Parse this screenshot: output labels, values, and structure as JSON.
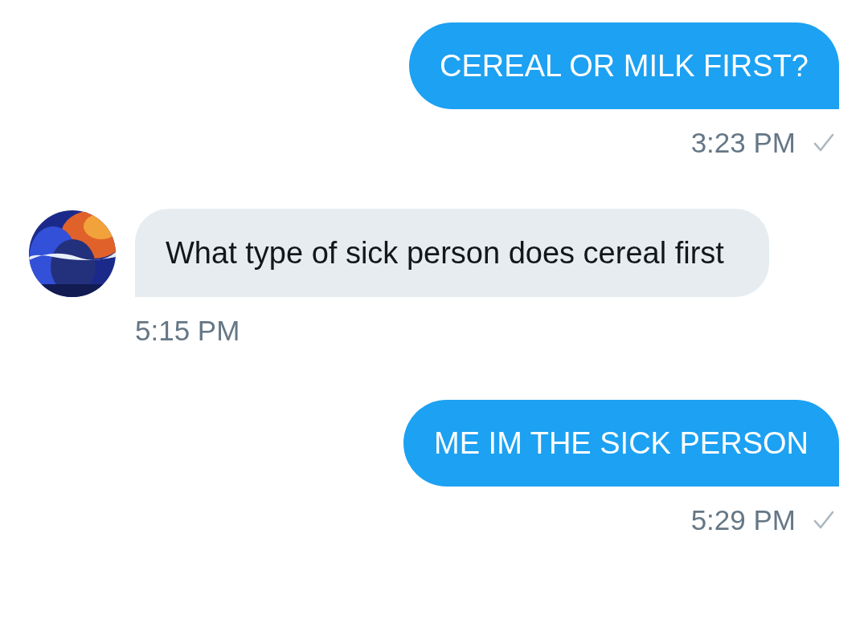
{
  "messages": [
    {
      "kind": "sent",
      "text": "CEREAL OR MILK FIRST?",
      "time": "3:23 PM"
    },
    {
      "kind": "received",
      "text": "What type of sick person does cereal first",
      "time": "5:15 PM"
    },
    {
      "kind": "sent",
      "text": "ME IM THE SICK PERSON",
      "time": "5:29 PM"
    }
  ]
}
